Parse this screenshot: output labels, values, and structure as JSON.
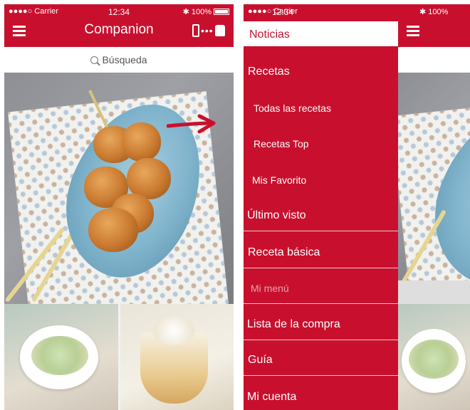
{
  "status_bar": {
    "carrier": "●●●●○ Carrier",
    "time": "12:34",
    "battery": "100%"
  },
  "app": {
    "title": "Companion",
    "device_icon": "thermomix-connect-icon"
  },
  "search": {
    "placeholder": "Búsqueda"
  },
  "menu": {
    "items": [
      {
        "label": "Noticias",
        "kind": "active"
      },
      {
        "label": "Recetas",
        "kind": "section"
      },
      {
        "label": "Todas las recetas",
        "kind": "sub"
      },
      {
        "label": "Recetas Top",
        "kind": "sub"
      },
      {
        "label": "Mis Favorito",
        "kind": "sub"
      },
      {
        "label": "Último visto",
        "kind": "section"
      },
      {
        "label": "Receta básica",
        "kind": "section"
      },
      {
        "label": "Mi menú",
        "kind": "disabled"
      },
      {
        "label": "Lista de la compra",
        "kind": "section"
      },
      {
        "label": "Guía",
        "kind": "section"
      },
      {
        "label": "Mi cuenta",
        "kind": "section"
      }
    ]
  },
  "colors": {
    "brand_red": "#c8102e",
    "background": "#f2f2f2",
    "white": "#ffffff"
  },
  "icons": [
    "hamburger-menu-icon",
    "search-icon",
    "bluetooth-icon",
    "battery-icon",
    "wifi-icon",
    "arrow-right-icon"
  ]
}
